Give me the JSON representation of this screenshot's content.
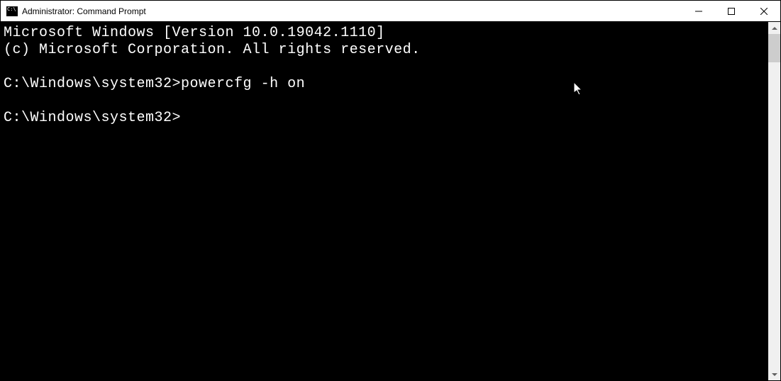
{
  "titlebar": {
    "title": "Administrator: Command Prompt"
  },
  "terminal": {
    "line1": "Microsoft Windows [Version 10.0.19042.1110]",
    "line2": "(c) Microsoft Corporation. All rights reserved.",
    "blank1": "",
    "prompt1_path": "C:\\Windows\\system32>",
    "prompt1_cmd": "powercfg -h on",
    "blank2": "",
    "prompt2_path": "C:\\Windows\\system32>"
  }
}
